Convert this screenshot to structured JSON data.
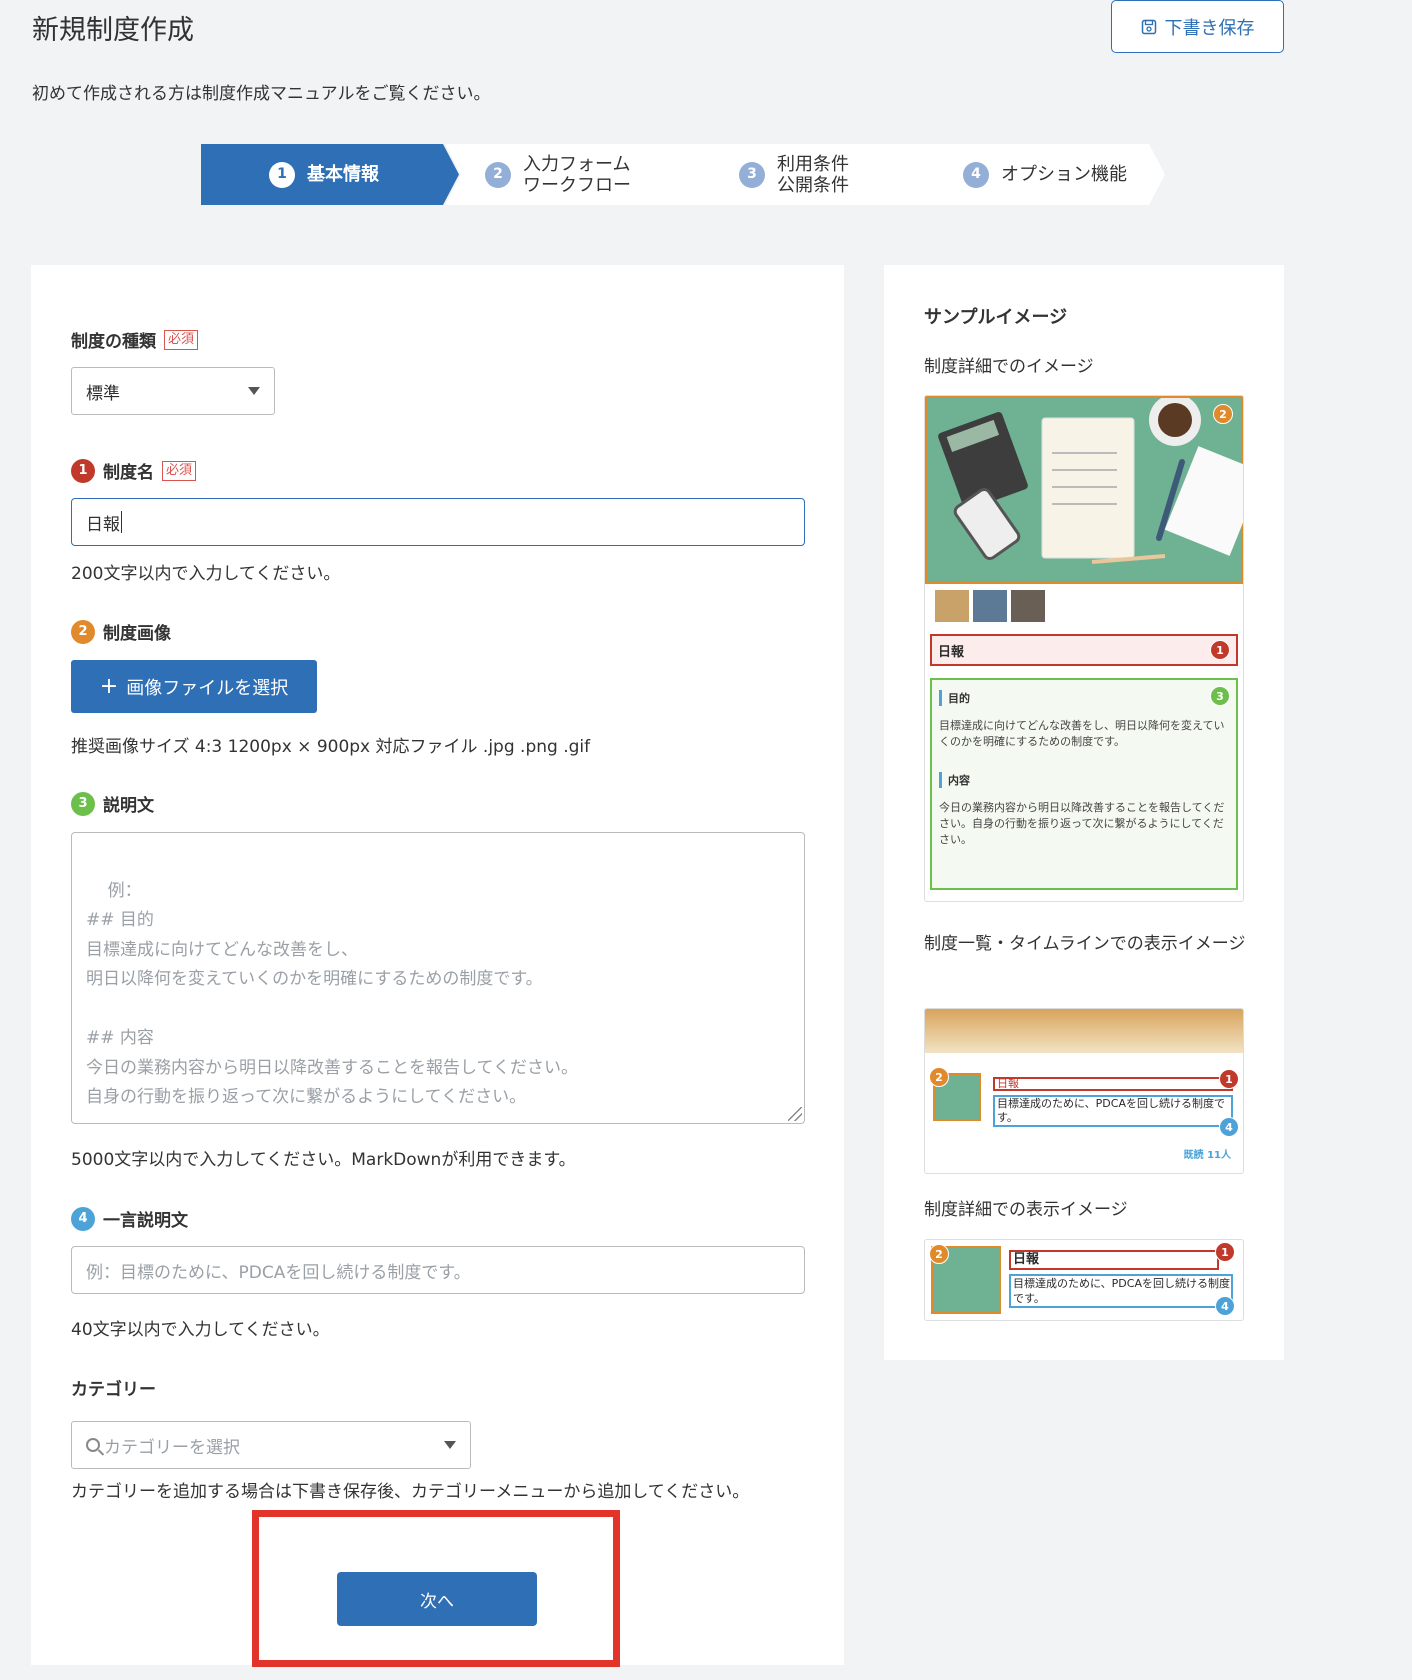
{
  "header": {
    "title": "新規制度作成",
    "draft_button": "下書き保存",
    "subtitle": "初めて作成される方は制度作成マニュアルをご覧ください。"
  },
  "stepper": {
    "steps": [
      {
        "num": "1",
        "line1": "基本情報",
        "line2": ""
      },
      {
        "num": "2",
        "line1": "入力フォーム",
        "line2": "ワークフロー"
      },
      {
        "num": "3",
        "line1": "利用条件",
        "line2": "公開条件"
      },
      {
        "num": "4",
        "line1": "オプション機能",
        "line2": ""
      }
    ]
  },
  "form": {
    "required_tag": "必須",
    "type": {
      "label": "制度の種類",
      "value": "標準"
    },
    "name": {
      "num": "1",
      "label": "制度名",
      "value": "日報",
      "help": "200文字以内で入力してください。"
    },
    "image": {
      "num": "2",
      "label": "制度画像",
      "button": "画像ファイルを選択",
      "help": "推奨画像サイズ 4:3 1200px × 900px 対応ファイル .jpg .png .gif"
    },
    "description": {
      "num": "3",
      "label": "説明文",
      "placeholder": "例：\n## 目的\n目標達成に向けてどんな改善をし、\n明日以降何を変えていくのかを明確にするための制度です。\n\n## 内容\n今日の業務内容から明日以降改善することを報告してください。\n自身の行動を振り返って次に繋がるようにしてください。",
      "help": "5000文字以内で入力してください。MarkDownが利用できます。"
    },
    "short_desc": {
      "num": "4",
      "label": "一言説明文",
      "placeholder": "例：目標のために、PDCAを回し続ける制度です。",
      "help": "40文字以内で入力してください。"
    },
    "category": {
      "label": "カテゴリー",
      "placeholder": "カテゴリーを選択",
      "help": "カテゴリーを追加する場合は下書き保存後、カテゴリーメニューから追加してください。"
    },
    "next_button": "次へ"
  },
  "sample": {
    "title": "サンプルイメージ",
    "detail_label": "制度詳細でのイメージ",
    "detail_mock": {
      "name": "日報",
      "purpose_head": "目的",
      "purpose_text": "目標達成に向けてどんな改善をし、明日以降何を変えていくのかを明確にするための制度です。",
      "content_head": "内容",
      "content_text": "今日の業務内容から明日以降改善することを報告してください。自身の行動を振り返って次に繋がるようにしてください。"
    },
    "list_label": "制度一覧・タイムラインでの表示イメージ",
    "list_mock": {
      "name": "日報",
      "desc": "目標達成のために、PDCAを回し続ける制度です。",
      "read": "既読 11人"
    },
    "detail2_label": "制度詳細での表示イメージ",
    "detail2_mock": {
      "name": "日報",
      "desc": "目標達成のために、PDCAを回し続ける制度です。"
    }
  },
  "colors": {
    "primary": "#2f6fb5",
    "required": "#d9534f",
    "highlight": "#e2342a",
    "background": "#f2f3f5"
  }
}
